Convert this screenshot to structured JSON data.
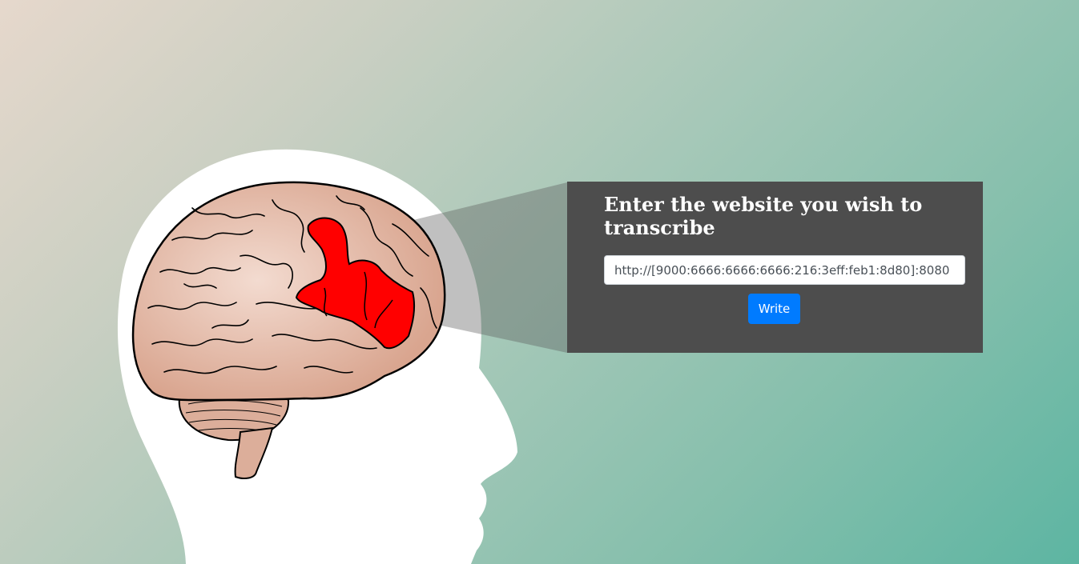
{
  "form": {
    "title": "Enter the website you wish to transcribe",
    "url_value": "http://[9000:6666:6666:6666:216:3eff:feb1:8d80]:8080",
    "submit_label": "Write"
  },
  "colors": {
    "panel_background": "#4d4d4d",
    "button_background": "#007bff",
    "highlight_region": "#ff0000",
    "brain_fill": "#e8bfae",
    "head_fill": "#ffffff"
  },
  "icons": {
    "illustration": "head-with-brain-illustration"
  }
}
